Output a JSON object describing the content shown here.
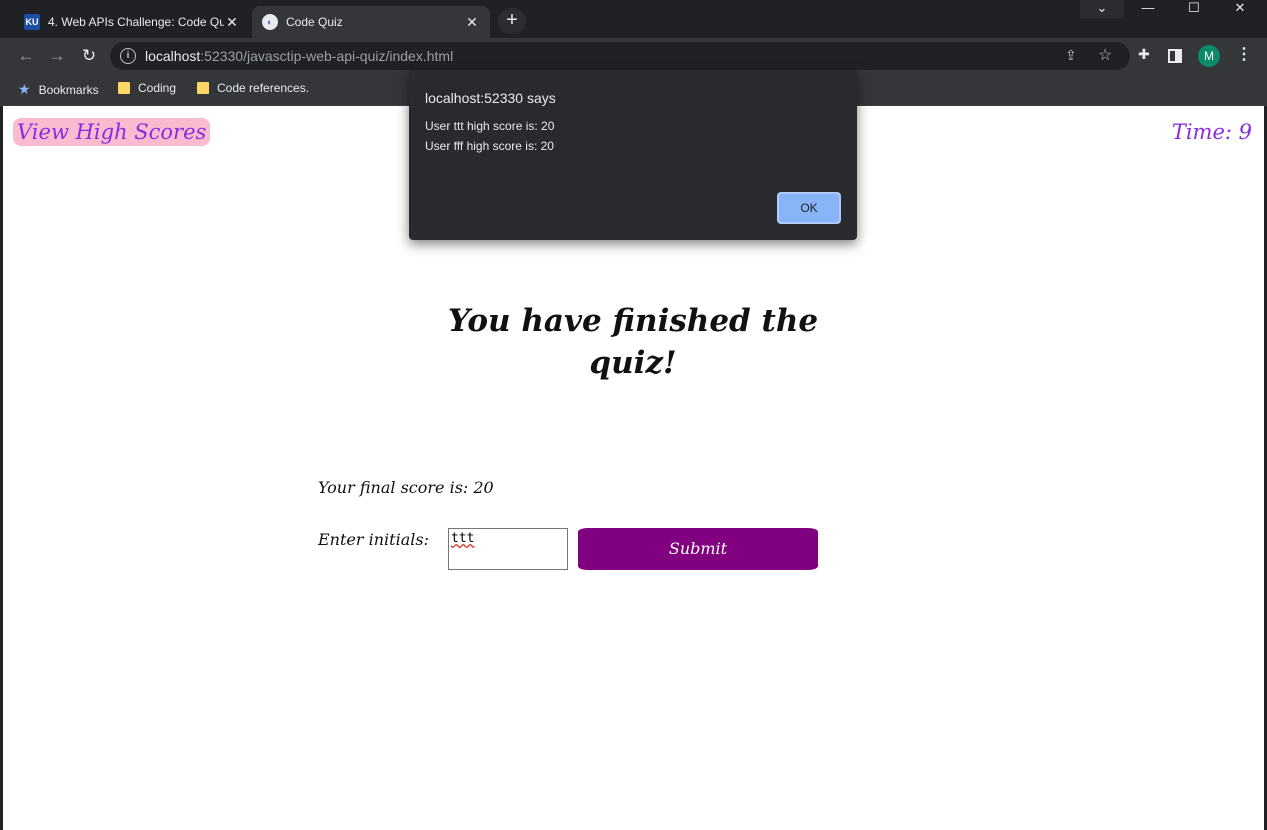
{
  "browser": {
    "tabs": [
      {
        "title": "4. Web APIs Challenge: Code Quiz",
        "favicon": "ku-favicon-icon",
        "favicon_text": "KU",
        "active": false
      },
      {
        "title": "Code Quiz",
        "favicon": "code-quiz-favicon-icon",
        "active": true
      }
    ],
    "close_glyph": "✕",
    "newtab_glyph": "+",
    "window_controls": {
      "tab_search": "⌄",
      "minimize": "—",
      "maximize": "☐",
      "close": "✕"
    },
    "url_host": "localhost",
    "url_rest": ":52330/javasctip-web-api-quiz/index.html",
    "profile_initial": "M",
    "profile_color": "#0b8a6a"
  },
  "bookmarks": [
    {
      "label": "Bookmarks",
      "icon": "star-icon"
    },
    {
      "label": "Coding",
      "icon": "folder-icon"
    },
    {
      "label": "Code references.",
      "icon": "folder-icon"
    }
  ],
  "page": {
    "highscores_label": "View High Scores",
    "timer_text": "Time: 9",
    "done_title": "You have finished the quiz!",
    "final_score_text": "Your final score is: 20",
    "initials_label": "Enter initials:",
    "initials_value": "ttt",
    "submit_label": "Submit",
    "accent_color": "#8a2be2",
    "submit_color": "#800080"
  },
  "dialog": {
    "title": "localhost:52330 says",
    "lines": [
      "User ttt high score is: 20",
      "User fff high score is: 20"
    ],
    "ok_label": "OK"
  }
}
